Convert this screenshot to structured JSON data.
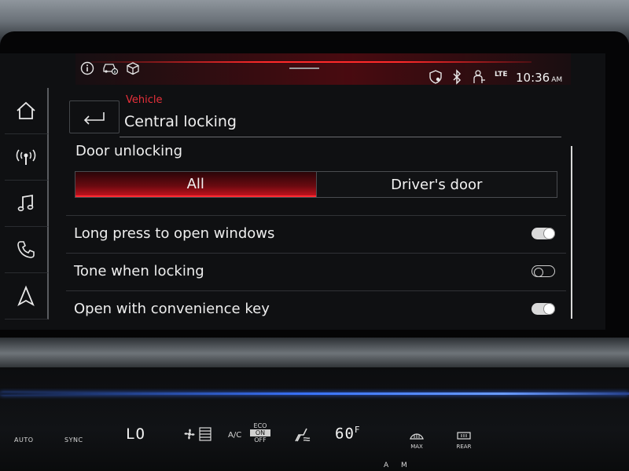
{
  "status_bar": {
    "icons": [
      "info-icon",
      "car-service-icon",
      "package-icon",
      "location-shield-icon",
      "bluetooth-icon",
      "person-icon"
    ],
    "network": "LTE",
    "time": "10:36",
    "ampm": "AM"
  },
  "rail": {
    "items": [
      {
        "icon": "home-icon"
      },
      {
        "icon": "radio-icon"
      },
      {
        "icon": "music-note-icon"
      },
      {
        "icon": "phone-icon"
      },
      {
        "icon": "navigation-arrow-icon"
      }
    ]
  },
  "header": {
    "breadcrumb": "Vehicle",
    "title": "Central locking"
  },
  "door_unlocking": {
    "label": "Door unlocking",
    "options": [
      "All",
      "Driver's door"
    ],
    "selected": "All"
  },
  "settings": [
    {
      "label": "Long press to open windows",
      "state": "on"
    },
    {
      "label": "Tone when locking",
      "state": "off"
    },
    {
      "label": "Open with convenience key",
      "state": "on"
    }
  ],
  "climate": {
    "auto": "AUTO",
    "sync": "SYNC",
    "fan_level": "LO",
    "ac": "A/C",
    "eco": "ECO",
    "on_label": "ON",
    "off_label": "OFF",
    "temperature": "60",
    "unit": "F",
    "max": "MAX",
    "rear": "REAR",
    "a_label": "A",
    "m_label": "M"
  },
  "colors": {
    "accent_red": "#e8303a",
    "ambient_blue": "#3a74ff"
  }
}
